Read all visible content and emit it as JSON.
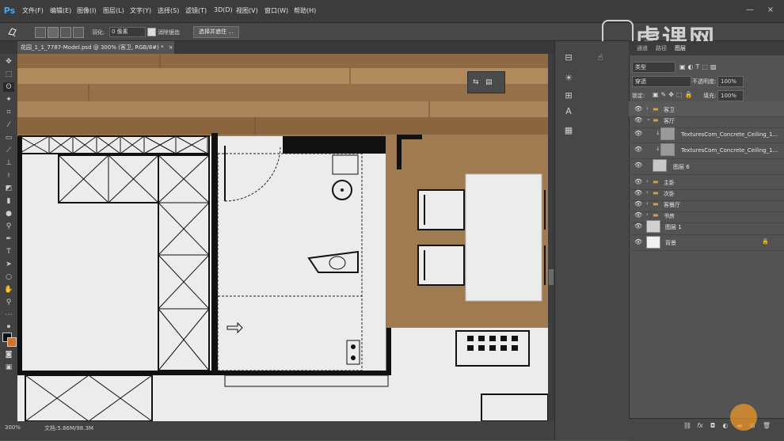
{
  "app": {
    "logo": "Ps"
  },
  "menubar": {
    "items": [
      "文件(F)",
      "编辑(E)",
      "图像(I)",
      "图层(L)",
      "文字(Y)",
      "选择(S)",
      "滤镜(T)",
      "3D(D)",
      "视图(V)",
      "窗口(W)",
      "帮助(H)"
    ],
    "minimize_glyph": "—",
    "close_glyph": "×"
  },
  "options": {
    "feather_label": "羽化:",
    "feather_value": "0 像素",
    "antialias_label": "消除锯齿",
    "select_mask_label": "选择并遮住 ..."
  },
  "watermark": {
    "text": "虎课网"
  },
  "document": {
    "tab_title": "花园_1_1_7787-Model.psd @ 300% (客卫, RGB/8#) *",
    "close_glyph": "×",
    "zoom": "300%",
    "doc_size": "文档:5.86M/98.3M"
  },
  "layers_panel": {
    "tabs": [
      "通道",
      "路径",
      "图层"
    ],
    "filter_label": "类型",
    "blend_mode": "穿透",
    "opacity_label": "不透明度:",
    "opacity_value": "100%",
    "lock_label": "锁定:",
    "fill_label": "填充:",
    "fill_value": "100%",
    "layers": [
      {
        "name": "客卫",
        "kind": "group",
        "selected": true
      },
      {
        "name": "客厅",
        "kind": "group-open"
      },
      {
        "name": "TexturesCom_Concrete_Ceiling_1...",
        "kind": "texture"
      },
      {
        "name": "TexturesCom_Concrete_Ceiling_1...",
        "kind": "texture"
      },
      {
        "name": "图层 6",
        "kind": "pixel"
      },
      {
        "name": "主卧",
        "kind": "group"
      },
      {
        "name": "次卧",
        "kind": "group"
      },
      {
        "name": "客餐厅",
        "kind": "group"
      },
      {
        "name": "书房",
        "kind": "group"
      },
      {
        "name": "图层 1",
        "kind": "pixel"
      },
      {
        "name": "背景",
        "kind": "background"
      }
    ]
  },
  "colors": {
    "accent": "#3ea9ff",
    "selection": "#595959",
    "wood": "#a07a50",
    "floor": "#ececec",
    "cursor_highlight": "#ec9628"
  }
}
